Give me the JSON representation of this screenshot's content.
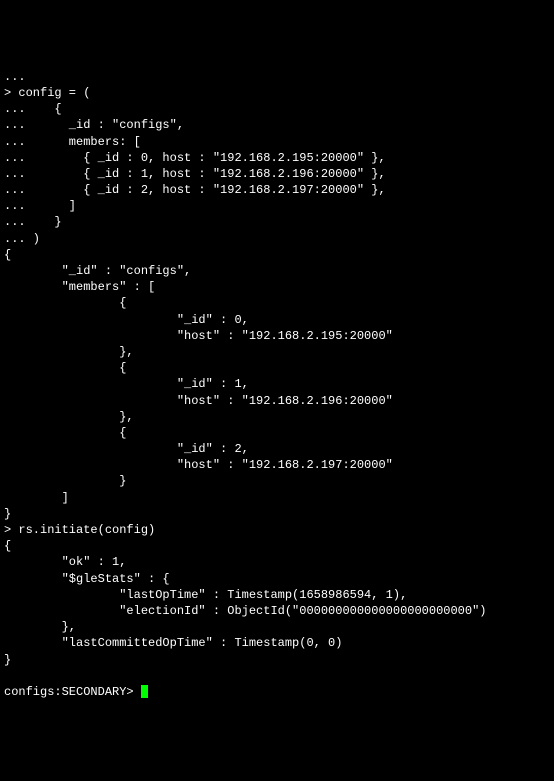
{
  "terminal": {
    "lines": [
      "...",
      "",
      "> config = (",
      "...    {",
      "...      _id : \"configs\",",
      "...      members: [",
      "...        { _id : 0, host : \"192.168.2.195:20000\" },",
      "...        { _id : 1, host : \"192.168.2.196:20000\" },",
      "...        { _id : 2, host : \"192.168.2.197:20000\" },",
      "...      ]",
      "...    }",
      "... )",
      "{",
      "        \"_id\" : \"configs\",",
      "        \"members\" : [",
      "                {",
      "                        \"_id\" : 0,",
      "                        \"host\" : \"192.168.2.195:20000\"",
      "                },",
      "                {",
      "                        \"_id\" : 1,",
      "                        \"host\" : \"192.168.2.196:20000\"",
      "                },",
      "                {",
      "                        \"_id\" : 2,",
      "                        \"host\" : \"192.168.2.197:20000\"",
      "                }",
      "        ]",
      "}",
      "> rs.initiate(config)",
      "{",
      "        \"ok\" : 1,",
      "        \"$gleStats\" : {",
      "                \"lastOpTime\" : Timestamp(1658986594, 1),",
      "                \"electionId\" : ObjectId(\"000000000000000000000000\")",
      "        },",
      "        \"lastCommittedOpTime\" : Timestamp(0, 0)",
      "}"
    ],
    "prompt": "configs:SECONDARY> "
  }
}
